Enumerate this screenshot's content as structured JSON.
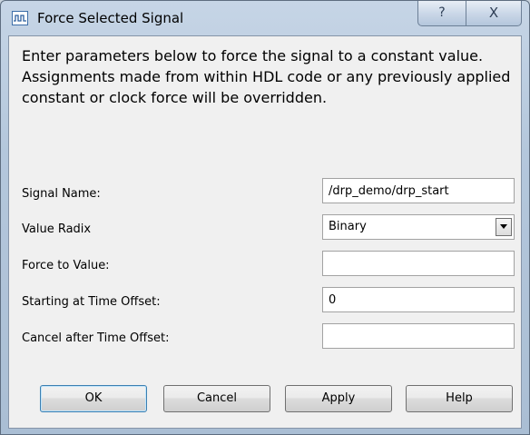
{
  "window": {
    "title": "Force Selected Signal",
    "help_glyph": "?",
    "close_glyph": "X"
  },
  "description": "Enter parameters below to force the signal to a constant value. Assignments made from within HDL code or any previously applied constant or clock force will be overridden.",
  "form": {
    "signal_name": {
      "label": "Signal Name:",
      "value": "/drp_demo/drp_start"
    },
    "value_radix": {
      "label": "Value Radix",
      "value": "Binary"
    },
    "force_to_value": {
      "label": "Force to Value:",
      "value": ""
    },
    "starting_offset": {
      "label": "Starting at Time Offset:",
      "value": "0"
    },
    "cancel_offset": {
      "label": "Cancel after Time Offset:",
      "value": ""
    }
  },
  "buttons": {
    "ok": "OK",
    "cancel": "Cancel",
    "apply": "Apply",
    "help": "Help"
  },
  "icons": {
    "app": "waveform-icon",
    "dropdown": "chevron-down-icon"
  }
}
